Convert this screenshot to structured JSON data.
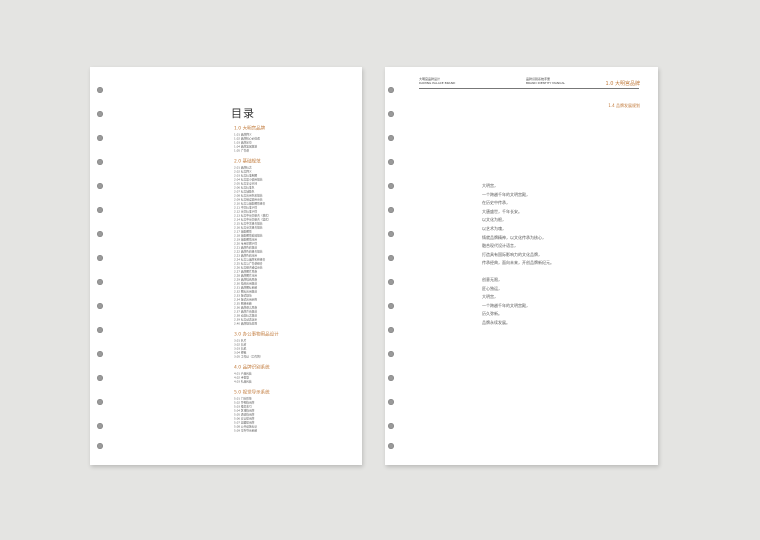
{
  "left_page": {
    "title": "目录",
    "sections": [
      {
        "heading": "1.0 大明宫品牌",
        "items": [
          "1.01 品牌释义",
          "1.02 品牌核心价值观",
          "1.03 品牌定位",
          "1.04 品牌发展规划",
          "1.05 广告语"
        ]
      },
      {
        "heading": "2.0 基础规范",
        "items": [
          "2.01 品牌标志",
          "2.02 标志释义",
          "2.03 标志标准制图",
          "2.04 标志最小使用规范",
          "2.05 标志安全空间",
          "2.06 标志标准色",
          "2.07 标志辅助色",
          "2.08 标志应用色彩规范",
          "2.09 标志错误使用示范",
          "2.10 标志与辅助图形组合",
          "2.11 中文标准字体",
          "2.12 英文标准字体",
          "2.13 标志中英文组合（横式）",
          "2.14 标志中英文组合（竖式）",
          "2.15 标志中文组合规范",
          "2.16 标志英文组合规范",
          "2.17 辅助图形",
          "2.18 辅助图形延展规范",
          "2.19 辅助图形应用",
          "2.20 专用印刷字体",
          "2.21 品牌色彩规范",
          "2.22 品牌色彩组合规范",
          "2.23 品牌色彩应用",
          "2.24 标志与品牌名称组合",
          "2.25 标志与广告语组合",
          "2.26 标志组合错误示范",
          "2.27 品牌图片风格",
          "2.28 品牌图片应用",
          "2.29 品牌插画风格",
          "2.30 插画应用规范",
          "2.31 品牌图标系统",
          "2.32 图标应用规范",
          "2.33 版式规范",
          "2.34 版式应用示例",
          "2.35 网格系统",
          "2.36 品牌语言风格",
          "2.37 品牌声音规范",
          "2.38 动态标志规范",
          "2.39 标志动态演示",
          "2.40 品牌规范总则"
        ]
      },
      {
        "heading": "3.0 办公事物用品设计",
        "items": [
          "3.01 名片",
          "3.02 信封",
          "3.03 信纸",
          "3.04 便笺",
          "3.05 工作证（工作牌）"
        ]
      },
      {
        "heading": "4.0 品牌识别系统",
        "items": [
          "4.01 产品包装",
          "4.02 手提袋",
          "4.03 礼品包装"
        ]
      },
      {
        "heading": "5.0 视觉导示系统",
        "items": [
          "5.01 门头形象",
          "5.02 导视指示牌",
          "5.03 楼层索引",
          "5.04 区域指示牌",
          "5.05 通道指示牌",
          "5.06 安全提示牌",
          "5.07 温馨提示牌",
          "5.08 公共设施标识",
          "5.09 室外导示系统"
        ]
      }
    ]
  },
  "right_page": {
    "header_left": [
      "大明宫品牌设计",
      "DAMING PALACE BRAND"
    ],
    "header_right": [
      "品牌识别系统手册",
      "BRAND IDENTITY MANUAL"
    ],
    "section_title": "1.0 大明宫品牌",
    "subsection_title": "1.4 品牌发展规划",
    "paragraphs": [
      [
        "大明宫，",
        "一个跨越千年的文明宫殿，",
        "在历史中传承，",
        "大唐盛世，千年长安。",
        "以文化为根，",
        "以艺术为魂，",
        "铸就品牌精神，以文化传承为核心，",
        "融合现代设计语言，",
        "打造具有国际影响力的文化品牌，",
        "传承经典，面向未来，开创品牌新纪元。"
      ],
      [
        "创意无限，",
        "匠心独运，",
        "大明宫，",
        "一个跨越千年的文明宫殿，",
        "历久弥新。",
        "品牌永续发展。"
      ]
    ]
  }
}
